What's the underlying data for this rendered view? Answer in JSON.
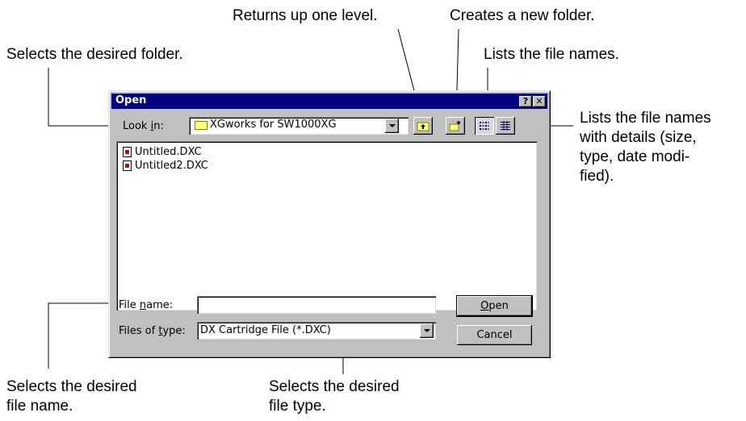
{
  "callouts": {
    "up_one_level": "Returns up one level.",
    "new_folder": "Creates a new folder.",
    "desired_folder": "Selects the desired folder.",
    "list": "Lists the file names.",
    "details_1": "Lists the file names",
    "details_2": "with details (size,",
    "details_3": "type, date modi-",
    "details_4": "fied).",
    "file_name_1": "Selects the desired",
    "file_name_2": "file name.",
    "file_type_1": "Selects the desired",
    "file_type_2": "file type."
  },
  "dialog": {
    "title": "Open",
    "help_label": "?",
    "close_label": "✕",
    "look_in": {
      "prefix": "Look ",
      "accel": "i",
      "suffix": "n:",
      "value": "XGworks for SW1000XG"
    },
    "files": [
      "Untitled.DXC",
      "Untitled2.DXC"
    ],
    "file_name": {
      "prefix": "File ",
      "accel": "n",
      "suffix": "ame:",
      "value": ""
    },
    "file_type": {
      "prefix": "Files of ",
      "accel": "t",
      "suffix": "ype:",
      "value": "DX Cartridge File (*.DXC)"
    },
    "open_button": {
      "accel": "O",
      "rest": "pen"
    },
    "cancel_button": "Cancel"
  },
  "icons": [
    "folder-icon",
    "up-one-level-icon",
    "new-folder-icon",
    "list-view-icon",
    "details-view-icon",
    "dropdown-arrow-icon",
    "dxc-file-icon"
  ],
  "colors": {
    "titlebar": "#000080",
    "dialog_bg": "#c0c0c0"
  }
}
